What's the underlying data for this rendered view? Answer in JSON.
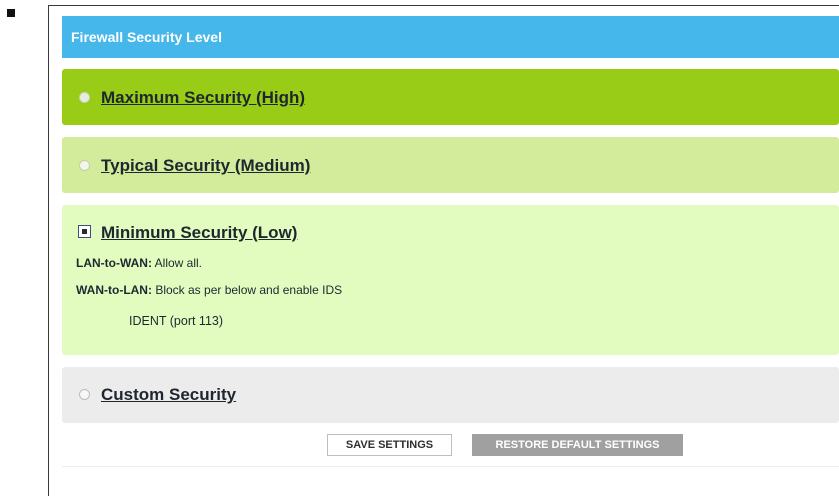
{
  "header": {
    "title": "Firewall Security Level"
  },
  "options": {
    "maximum": {
      "label": "Maximum Security (High)",
      "selected": false
    },
    "typical": {
      "label": "Typical Security (Medium)",
      "selected": false
    },
    "minimum": {
      "label": "Minimum Security (Low)",
      "selected": true,
      "lan_to_wan_label": "LAN-to-WAN:",
      "lan_to_wan_value": "Allow all.",
      "wan_to_lan_label": "WAN-to-LAN:",
      "wan_to_lan_value": "Block as per below and enable IDS",
      "ident": "IDENT (port 113)"
    },
    "custom": {
      "label": "Custom Security",
      "selected": false
    }
  },
  "buttons": {
    "save": "SAVE SETTINGS",
    "restore": "RESTORE DEFAULT SETTINGS"
  },
  "colors": {
    "header": "#46b7ea",
    "high": "#98cc17",
    "medium": "#d3ec9b",
    "low": "#e2fcc0",
    "custom": "#ececec",
    "restore_button": "#a0a0a0"
  }
}
